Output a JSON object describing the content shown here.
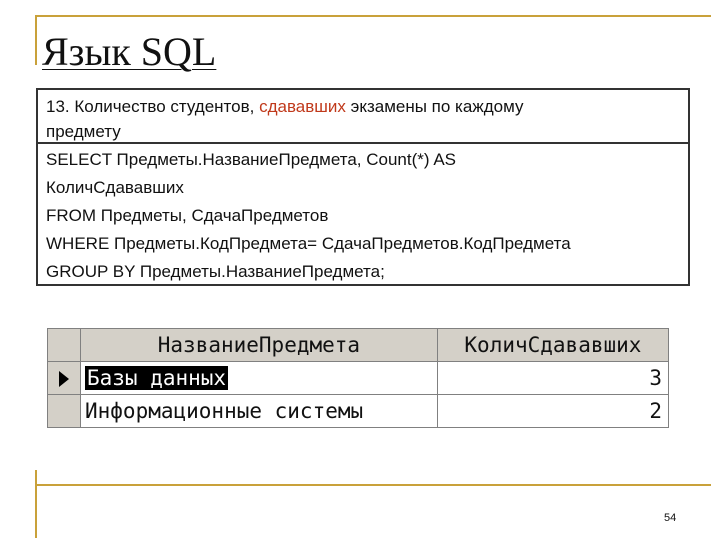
{
  "slide": {
    "title": "Язык SQL",
    "page_number": "54"
  },
  "query_box": {
    "heading_part1": "13. Количество студентов, ",
    "heading_highlight": "сдававших",
    "heading_part2": " экзамены по каждому",
    "heading_line2": "предмету",
    "sql_lines": [
      "SELECT Предметы.НазваниеПредмета, Count(*) AS",
      "КоличСдававших",
      "FROM Предметы, СдачаПредметов",
      "WHERE Предметы.КодПредмета= СдачаПредметов.КодПредмета",
      "GROUP BY Предметы.НазваниеПредмета;"
    ]
  },
  "result_grid": {
    "columns": [
      "НазваниеПредмета",
      "КоличСдававших"
    ],
    "rows": [
      {
        "name": "Базы данных",
        "count": "3"
      },
      {
        "name": "Информационные системы",
        "count": "2"
      }
    ]
  },
  "colors": {
    "accent_line": "#c9a13a",
    "highlight_text": "#c0391b"
  }
}
